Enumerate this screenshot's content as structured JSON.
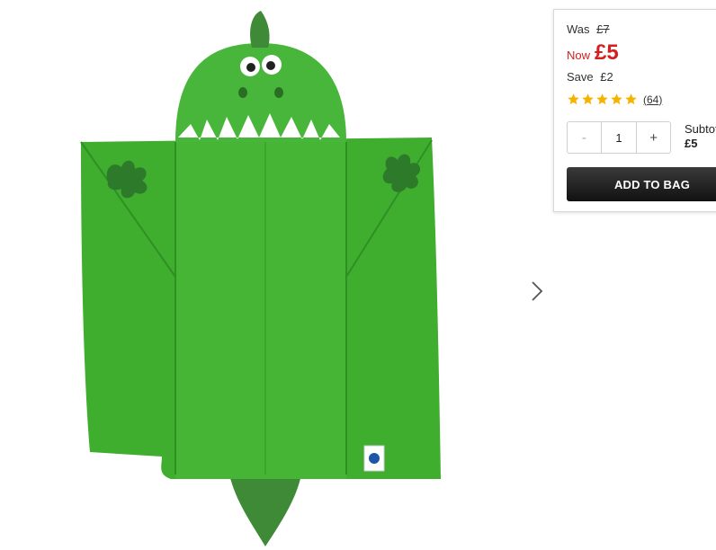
{
  "product": {
    "image_alt": "Green dinosaur hooded towel"
  },
  "gallery": {
    "next_icon": "chevron-right-icon"
  },
  "pricing": {
    "was_label": "Was",
    "was_value": "£7",
    "now_label": "Now",
    "now_value": "£5",
    "save_label": "Save",
    "save_value": "£2",
    "now_color": "#d21f1f"
  },
  "rating": {
    "stars": 5,
    "max_stars": 5,
    "count": "64",
    "star_color": "#f5b301"
  },
  "quantity": {
    "minus_label": "-",
    "value": "1",
    "plus_label": "+"
  },
  "subtotal": {
    "label": "Subtotal",
    "value": "£5"
  },
  "actions": {
    "add_to_bag_label": "ADD TO BAG"
  }
}
